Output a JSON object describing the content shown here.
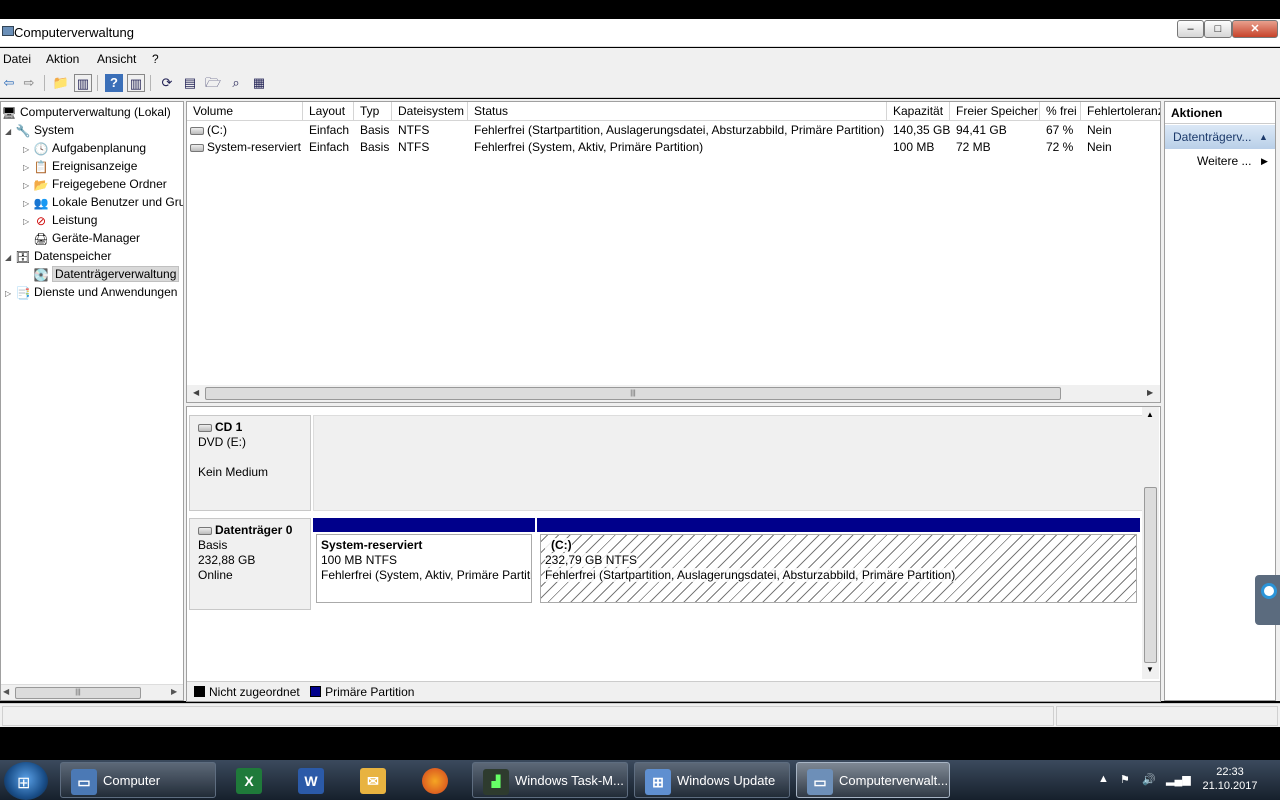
{
  "window": {
    "title": "Computerverwaltung",
    "controls": {
      "minimize": "–",
      "maximize": "□",
      "close": "✕"
    }
  },
  "menu": [
    "Datei",
    "Aktion",
    "Ansicht",
    "?"
  ],
  "tree": {
    "items": [
      {
        "label": "Computerverwaltung (Lokal)",
        "icon": "computer-management-icon"
      },
      {
        "label": "System",
        "icon": "tools-icon"
      },
      {
        "label": "Aufgabenplanung",
        "icon": "clock-icon"
      },
      {
        "label": "Ereignisanzeige",
        "icon": "event-viewer-icon"
      },
      {
        "label": "Freigegebene Ordner",
        "icon": "shared-folder-icon"
      },
      {
        "label": "Lokale Benutzer und Gru",
        "icon": "users-icon"
      },
      {
        "label": "Leistung",
        "icon": "performance-icon"
      },
      {
        "label": "Geräte-Manager",
        "icon": "device-manager-icon"
      },
      {
        "label": "Datenspeicher",
        "icon": "storage-icon"
      },
      {
        "label": "Datenträgerverwaltung",
        "icon": "disk-management-icon"
      },
      {
        "label": "Dienste und Anwendungen",
        "icon": "services-icon"
      }
    ]
  },
  "volumes": {
    "columns": [
      "Volume",
      "Layout",
      "Typ",
      "Dateisystem",
      "Status",
      "Kapazität",
      "Freier Speicher",
      "% frei",
      "Fehlertoleranz"
    ],
    "rows": [
      {
        "volume": "(C:)",
        "layout": "Einfach",
        "typ": "Basis",
        "fs": "NTFS",
        "status": "Fehlerfrei (Startpartition, Auslagerungsdatei, Absturzabbild, Primäre Partition)",
        "capacity": "140,35 GB",
        "free": "94,41 GB",
        "pct": "67 %",
        "ft": "Nein"
      },
      {
        "volume": "System-reserviert",
        "layout": "Einfach",
        "typ": "Basis",
        "fs": "NTFS",
        "status": "Fehlerfrei (System, Aktiv, Primäre Partition)",
        "capacity": "100 MB",
        "free": "72 MB",
        "pct": "72 %",
        "ft": "Nein"
      }
    ]
  },
  "disks": {
    "cd": {
      "name": "CD 1",
      "line1": "DVD (E:)",
      "line3": "Kein Medium"
    },
    "disk0": {
      "name": "Datenträger 0",
      "line1": "Basis",
      "line2": "232,88 GB",
      "line3": "Online"
    },
    "partitions": [
      {
        "name": "System-reserviert",
        "size": "100 MB NTFS",
        "status": "Fehlerfrei (System, Aktiv, Primäre Partiti"
      },
      {
        "name": "(C:)",
        "size": "232,79 GB NTFS",
        "status": "Fehlerfrei (Startpartition, Auslagerungsdatei, Absturzabbild, Primäre Partition)"
      }
    ]
  },
  "legend": [
    {
      "label": "Nicht zugeordnet",
      "color": "#000000"
    },
    {
      "label": "Primäre Partition",
      "color": "#00008b"
    }
  ],
  "actions": {
    "header": "Aktionen",
    "section": "Datenträgerv...",
    "more": "Weitere ..."
  },
  "taskbar": {
    "tasks": [
      {
        "label": "Computer"
      },
      {
        "label": ""
      },
      {
        "label": ""
      },
      {
        "label": ""
      },
      {
        "label": ""
      },
      {
        "label": "Windows Task-M..."
      },
      {
        "label": "Windows Update"
      },
      {
        "label": "Computerverwalt..."
      }
    ],
    "clock": {
      "time": "22:33",
      "date": "21.10.2017"
    }
  },
  "colors": {
    "primary_partition": "#00008b",
    "unallocated": "#000000"
  }
}
